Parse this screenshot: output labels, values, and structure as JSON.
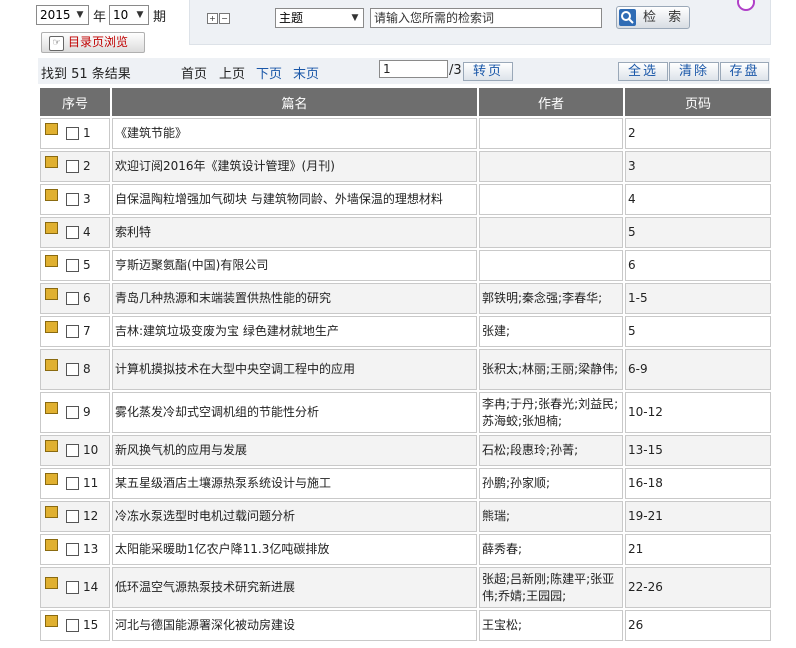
{
  "filters": {
    "year": "2015",
    "year_unit": "年",
    "issue": "10",
    "issue_unit": "期",
    "toc_browse_label": "目录页浏览",
    "field": "主题",
    "search_placeholder": "请输入您所需的检索词",
    "search_button": "检 索"
  },
  "results_bar": {
    "summary": "找到 51 条结果",
    "first": "首页",
    "prev": "上页",
    "next": "下页",
    "last": "末页",
    "page_value": "1",
    "page_total": "/3",
    "go": "转页",
    "select_all": "全选",
    "clear": "清除",
    "save": "存盘"
  },
  "table": {
    "headers": [
      "序号",
      "篇名",
      "作者",
      "页码"
    ],
    "rows": [
      {
        "no": "1",
        "title": "《建筑节能》",
        "author": "",
        "pages": "2"
      },
      {
        "no": "2",
        "title": "欢迎订阅2016年《建筑设计管理》(月刊)",
        "author": "",
        "pages": "3"
      },
      {
        "no": "3",
        "title": "自保温陶粒增强加气砌块 与建筑物同龄、外墙保温的理想材料",
        "author": "",
        "pages": "4"
      },
      {
        "no": "4",
        "title": "索利特",
        "author": "",
        "pages": "5"
      },
      {
        "no": "5",
        "title": "亨斯迈聚氨酯(中国)有限公司",
        "author": "",
        "pages": "6"
      },
      {
        "no": "6",
        "title": "青岛几种热源和末端装置供热性能的研究",
        "author": "郭铁明;秦念强;李春华;",
        "pages": "1-5"
      },
      {
        "no": "7",
        "title": "吉林:建筑垃圾变废为宝 绿色建材就地生产",
        "author": "张建;",
        "pages": "5"
      },
      {
        "no": "8",
        "title": "计算机摸拟技术在大型中央空调工程中的应用",
        "author": "张积太;林丽;王丽;梁静伟;",
        "pages": "6-9"
      },
      {
        "no": "9",
        "title": "雾化蒸发冷却式空调机组的节能性分析",
        "author": "李冉;于丹;张春光;刘益民;苏海蛟;张旭楠;",
        "pages": "10-12"
      },
      {
        "no": "10",
        "title": "新风换气机的应用与发展",
        "author": "石松;段惠玲;孙菁;",
        "pages": "13-15"
      },
      {
        "no": "11",
        "title": "某五星级酒店土壤源热泵系统设计与施工",
        "author": "孙鹏;孙家顺;",
        "pages": "16-18"
      },
      {
        "no": "12",
        "title": "冷冻水泵选型时电机过载问题分析",
        "author": "熊瑞;",
        "pages": "19-21"
      },
      {
        "no": "13",
        "title": "太阳能采暖助1亿农户降11.3亿吨碳排放",
        "author": "薛秀春;",
        "pages": "21"
      },
      {
        "no": "14",
        "title": "低环温空气源热泵技术研究新进展",
        "author": "张超;吕新刚;陈建平;张亚伟;乔婧;王园园;",
        "pages": "22-26"
      },
      {
        "no": "15",
        "title": "河北与德国能源署深化被动房建设",
        "author": "王宝松;",
        "pages": "26"
      }
    ]
  }
}
